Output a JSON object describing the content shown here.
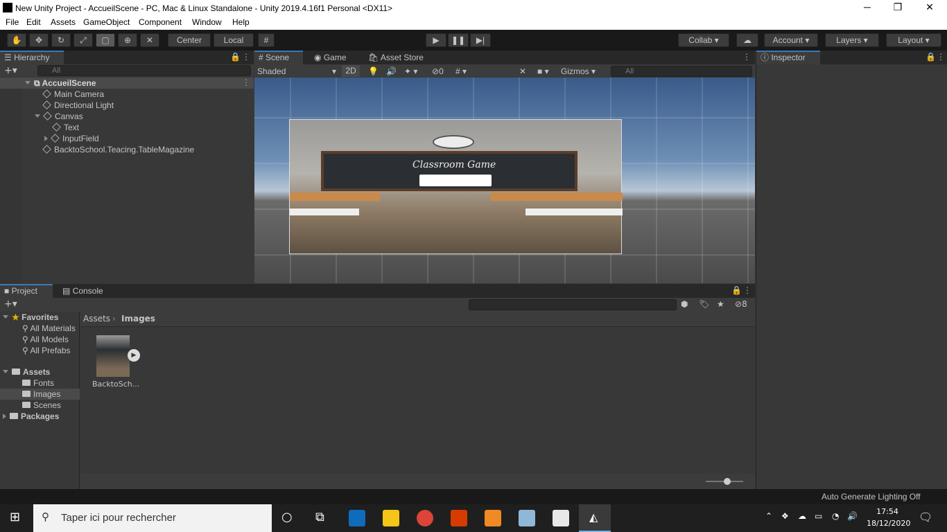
{
  "window": {
    "title": "New Unity Project - AccueilScene - PC, Mac & Linux Standalone - Unity 2019.4.16f1 Personal <DX11>",
    "minimize": "─",
    "maximize": "❐",
    "close": "✕"
  },
  "menu": [
    "File",
    "Edit",
    "Assets",
    "GameObject",
    "Component",
    "Window",
    "Help"
  ],
  "toolbar": {
    "pivot_center": "Center",
    "pivot_local": "Local",
    "collab": "Collab",
    "account": "Account",
    "layers": "Layers",
    "layout": "Layout"
  },
  "hierarchy": {
    "tab": "Hierarchy",
    "search_placeholder": "All",
    "scene": "AccueilScene",
    "items": [
      "Main Camera",
      "Directional Light",
      "Canvas",
      "Text",
      "InputField",
      "BacktoSchool.Teacing.TableMagazine"
    ]
  },
  "scene_view": {
    "tabs": [
      "Scene",
      "Game",
      "Asset Store"
    ],
    "shading": "Shaded",
    "mode_2d": "2D",
    "hidden_count": "0",
    "gizmos": "Gizmos",
    "search_placeholder": "All",
    "overlay_title": "Classroom Game"
  },
  "inspector": {
    "tab": "Inspector"
  },
  "project": {
    "tabs": [
      "Project",
      "Console"
    ],
    "hidden_count": "8",
    "favorites_label": "Favorites",
    "favorites": [
      "All Materials",
      "All Models",
      "All Prefabs"
    ],
    "assets_label": "Assets",
    "assets": [
      "Fonts",
      "Images",
      "Scenes"
    ],
    "packages_label": "Packages",
    "breadcrumb": [
      "Assets",
      "Images"
    ],
    "files": [
      {
        "name": "BacktoSch..."
      }
    ]
  },
  "statusbar": {
    "text": "Auto Generate Lighting Off"
  },
  "taskbar": {
    "search_placeholder": "Taper ici pour rechercher",
    "time": "17:54",
    "date": "18/12/2020"
  },
  "colors": {
    "accent": "#3a79bb",
    "panel": "#383838",
    "toolbar": "#191919",
    "selection": "#4a4a4a"
  }
}
